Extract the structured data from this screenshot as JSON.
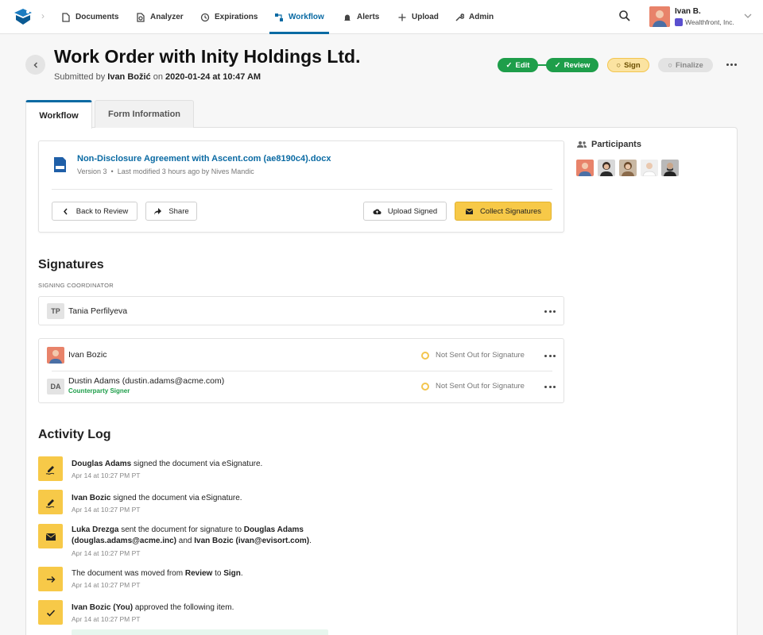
{
  "nav": {
    "items": [
      {
        "label": "Documents",
        "icon": "document-icon"
      },
      {
        "label": "Analyzer",
        "icon": "analyzer-icon"
      },
      {
        "label": "Expirations",
        "icon": "history-icon"
      },
      {
        "label": "Workflow",
        "icon": "workflow-icon",
        "active": true
      },
      {
        "label": "Alerts",
        "icon": "bell-icon"
      },
      {
        "label": "Upload",
        "icon": "plus-icon"
      },
      {
        "label": "Admin",
        "icon": "wrench-icon"
      }
    ],
    "user": {
      "name": "Ivan B.",
      "org": "Wealthfront, Inc."
    }
  },
  "header": {
    "title": "Work Order with Inity Holdings Ltd.",
    "submitted_prefix": "Submitted by",
    "submitter": "Ivan Božić",
    "on": "on",
    "date": "2020-01-24 at 10:47 AM",
    "steps": [
      {
        "label": "Edit",
        "state": "done"
      },
      {
        "label": "Review",
        "state": "done"
      },
      {
        "label": "Sign",
        "state": "current"
      },
      {
        "label": "Finalize",
        "state": "todo"
      }
    ]
  },
  "tabs": [
    {
      "label": "Workflow",
      "active": true
    },
    {
      "label": "Form Information",
      "active": false
    }
  ],
  "document": {
    "name": "Non-Disclosure Agreement with Ascent.com (ae8190c4).docx",
    "version": "Version 3",
    "modified": "Last modified 3 hours ago by Nives Mandic",
    "back_to_review": "Back to Review",
    "share": "Share",
    "upload_signed": "Upload Signed",
    "collect_signatures": "Collect Signatures"
  },
  "participants": {
    "title": "Participants",
    "count": 5
  },
  "signatures": {
    "title": "Signatures",
    "coordinator_label": "SIGNING COORDINATOR",
    "coordinator": {
      "initials": "TP",
      "name": "Tania Perfilyeva"
    },
    "signers": [
      {
        "name": "Ivan Bozic",
        "status": "Not Sent Out for Signature"
      },
      {
        "initials": "DA",
        "name": "Dustin Adams (dustin.adams@acme.com)",
        "role": "Counterparty Signer",
        "status": "Not Sent Out for Signature"
      }
    ]
  },
  "activity": {
    "title": "Activity Log",
    "entries": [
      {
        "icon": "signature-icon",
        "actor": "Douglas Adams",
        "text": " signed the document via eSignature.",
        "time": "Apr 14 at 10:27 PM PT"
      },
      {
        "icon": "signature-icon",
        "actor": "Ivan Bozic",
        "text": " signed the document via eSignature.",
        "time": "Apr 14 at 10:27 PM PT"
      },
      {
        "icon": "mail-icon",
        "actor": "Luka Drezga",
        "text": " sent the document for signature to ",
        "target1": "Douglas Adams",
        "line2_a": "(douglas.adams@acme.inc)",
        "and": " and ",
        "target2": "Ivan Bozic (ivan@evisort.com)",
        "end": ".",
        "time": "Apr 14 at 10:27 PM PT"
      },
      {
        "icon": "arrow-icon",
        "pre": "The document was moved from ",
        "from": "Review",
        "to_word": " to ",
        "to": "Sign",
        "end": ".",
        "time": "Apr 14 at 10:27 PM PT"
      },
      {
        "icon": "check-icon",
        "actor": "Ivan Bozic (You)",
        "text": " approved the following item.",
        "time": "Apr 14 at 10:27 PM PT"
      }
    ]
  },
  "colors": {
    "accent": "#0a6aa3",
    "done": "#1e9e4a",
    "warning": "#f7c948"
  }
}
